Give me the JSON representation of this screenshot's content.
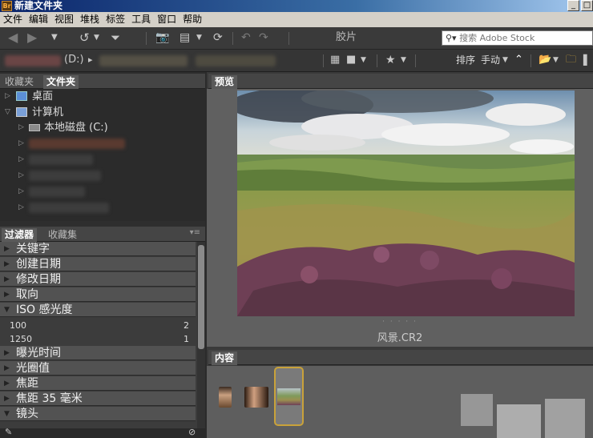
{
  "window": {
    "title": "新建文件夹",
    "app_icon_label": "Br"
  },
  "menu": [
    "文件",
    "编辑",
    "视图",
    "堆栈",
    "标签",
    "工具",
    "窗口",
    "帮助"
  ],
  "toolbar": {
    "workspace_label": "胶片",
    "search_placeholder": "搜索 Adobe Stock",
    "sort_label": "排序",
    "sort_mode": "手动"
  },
  "path_bar": {
    "drive": "(D:)"
  },
  "left_panel": {
    "tabs": [
      "收藏夹",
      "文件夹"
    ],
    "active_tab": "文件夹",
    "tree": [
      {
        "label": "桌面",
        "level": 1
      },
      {
        "label": "计算机",
        "level": 1,
        "expanded": true
      },
      {
        "label": "本地磁盘 (C:)",
        "level": 2
      }
    ]
  },
  "filter_panel": {
    "tabs": [
      "过滤器",
      "收藏集"
    ],
    "active_tab": "过滤器",
    "sections": [
      {
        "label": "关键字"
      },
      {
        "label": "创建日期"
      },
      {
        "label": "修改日期"
      },
      {
        "label": "取向"
      },
      {
        "label": "ISO 感光度",
        "expanded": true,
        "items": [
          {
            "value": "100",
            "count": "2"
          },
          {
            "value": "1250",
            "count": "1"
          }
        ]
      },
      {
        "label": "曝光时间"
      },
      {
        "label": "光圈值"
      },
      {
        "label": "焦距"
      },
      {
        "label": "焦距 35 毫米"
      },
      {
        "label": "镜头",
        "expanded": true
      }
    ]
  },
  "preview_panel": {
    "tab": "预览",
    "caption": "风景.CR2"
  },
  "content_panel": {
    "tab": "内容"
  }
}
